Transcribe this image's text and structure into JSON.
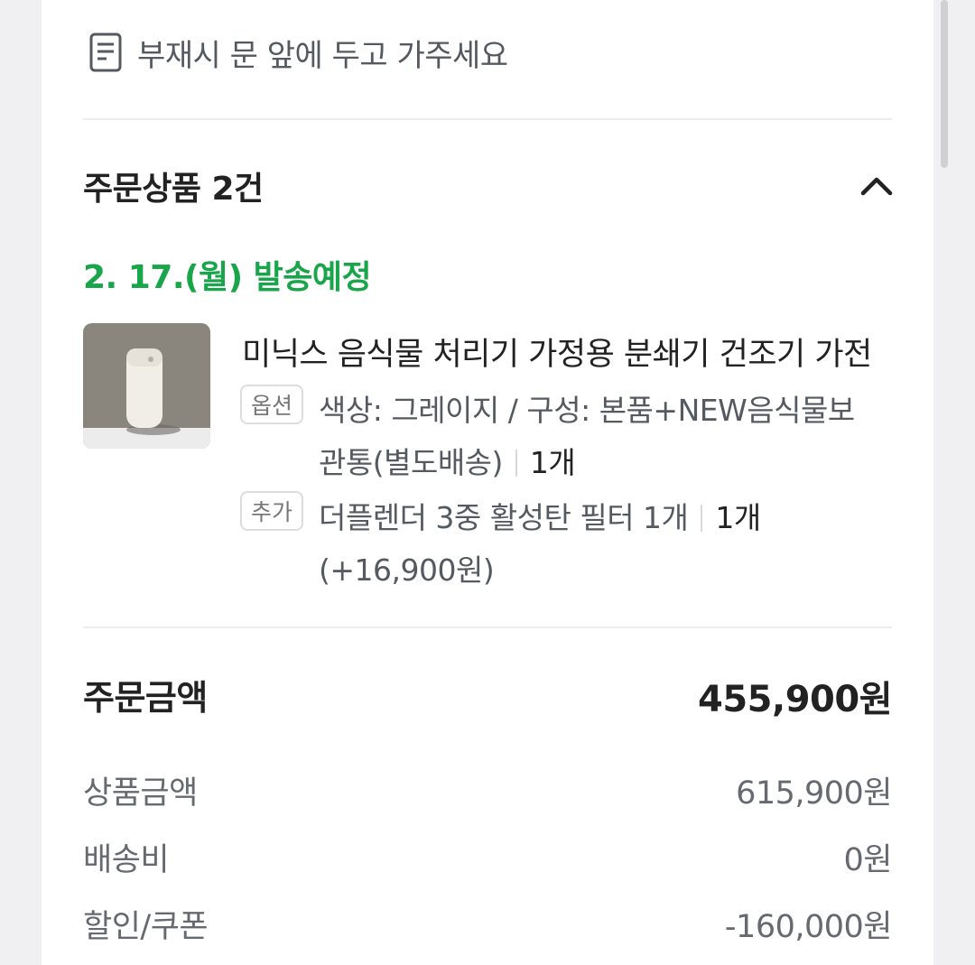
{
  "delivery": {
    "memo": "부재시 문 앞에 두고 가주세요",
    "icon": "memo-icon"
  },
  "order_items": {
    "title": "주문상품 2건",
    "toggle_icon": "chevron-up-icon",
    "ship_date": "2. 17.(월) 발송예정",
    "product": {
      "name": "미닉스 음식물 처리기 가정용 분쇄기 건조기 가전",
      "option_tag": "옵션",
      "option_line1": "색상: 그레이지 / 구성: 본품+NEW음식물보",
      "option_line2": "관통(별도배송)",
      "option_qty": "1개",
      "addon_tag": "추가",
      "addon_line1": "더플렌더 3중 활성탄 필터 1개",
      "addon_qty": "1개",
      "addon_price": "(+16,900원)"
    }
  },
  "summary": {
    "total_label": "주문금액",
    "total_value": "455,900원",
    "rows": [
      {
        "label": "상품금액",
        "value": "615,900원"
      },
      {
        "label": "배송비",
        "value": "0원"
      },
      {
        "label": "할인/쿠폰",
        "value": "-160,000원"
      }
    ]
  },
  "colors": {
    "accent_green": "#19a54a",
    "text_dark": "#222222",
    "text_gray": "#555a60"
  }
}
